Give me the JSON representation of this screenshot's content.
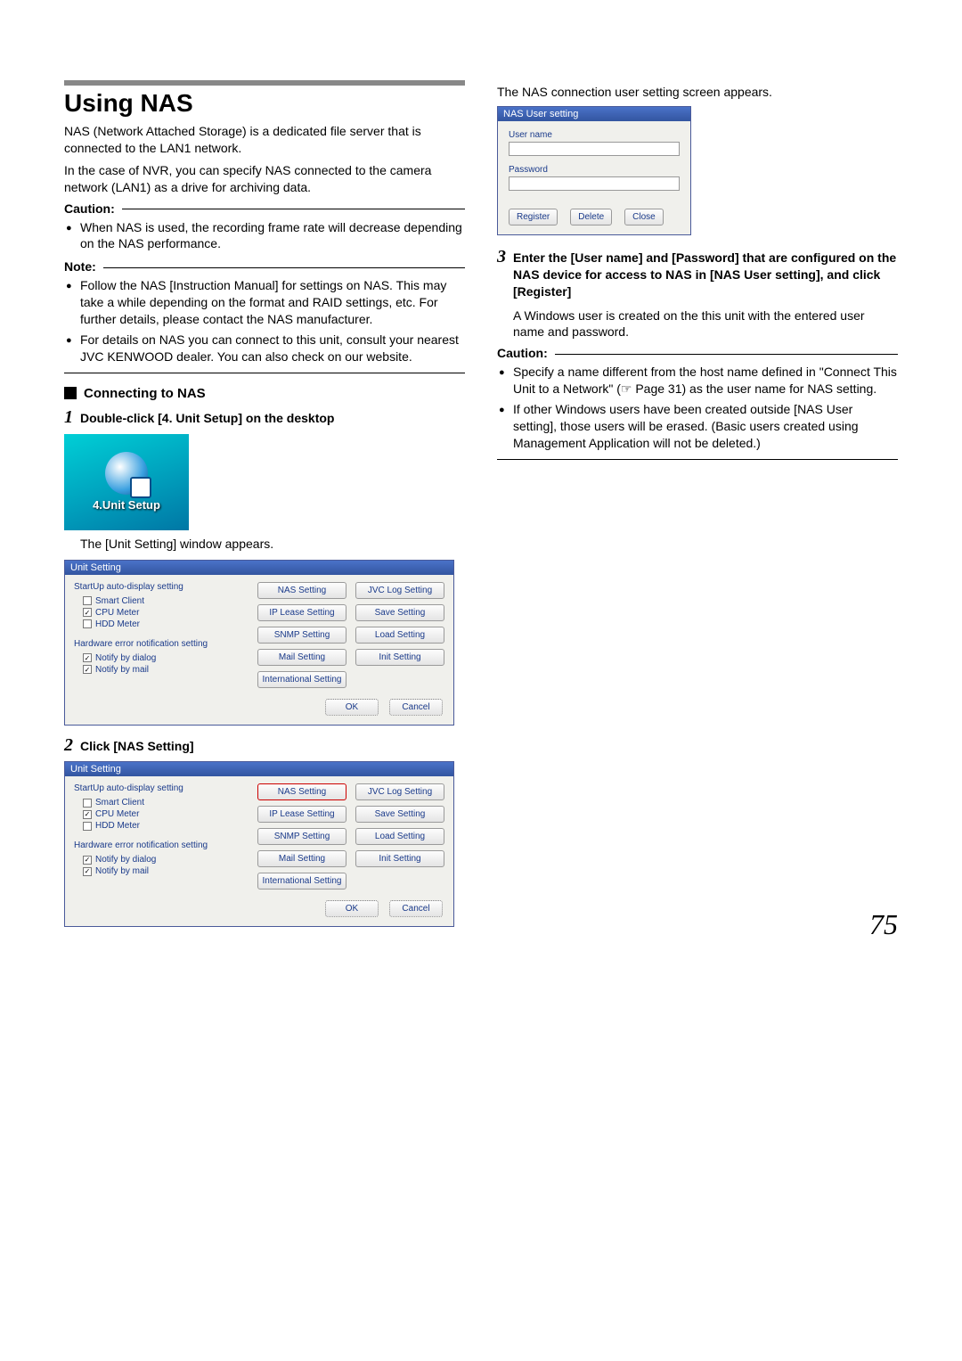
{
  "heading": "Using NAS",
  "intro1": "NAS (Network Attached Storage) is a dedicated file server that is connected to the LAN1 network.",
  "intro2": "In the case of NVR, you can specify NAS connected to the camera network (LAN1) as a drive for archiving data.",
  "caution_label": "Caution:",
  "note_label": "Note:",
  "caution1_items": [
    "When NAS is used, the recording frame rate will decrease depending on the NAS performance."
  ],
  "note1_items": [
    "Follow the NAS [Instruction Manual] for settings on NAS. This may take a while depending on the format and RAID settings, etc. For further details, please contact the NAS manufacturer.",
    "For details on NAS you can connect to this unit, consult your nearest JVC KENWOOD dealer. You can also check on our website."
  ],
  "subhead_connect": "Connecting to NAS",
  "step1": "Double-click [4. Unit Setup] on the desktop",
  "desktop_icon_label": "4.Unit Setup",
  "unit_window_caption": "The [Unit Setting] window appears.",
  "unit_dialog": {
    "title": "Unit Setting",
    "section_startup": "StartUp auto-display setting",
    "chk_smart": "Smart Client",
    "chk_cpu": "CPU Meter",
    "chk_hdd": "HDD Meter",
    "section_hw": "Hardware error notification setting",
    "chk_notify_dialog": "Notify by dialog",
    "chk_notify_mail": "Notify by mail",
    "btns_col1": [
      "NAS Setting",
      "IP Lease Setting",
      "SNMP Setting",
      "Mail Setting",
      "International Setting"
    ],
    "btns_col2": [
      "JVC Log Setting",
      "Save Setting",
      "Load Setting",
      "Init Setting"
    ],
    "ok": "OK",
    "cancel": "Cancel"
  },
  "step2": "Click [NAS Setting]",
  "col2_caption": "The NAS connection user setting screen appears.",
  "nas_dialog": {
    "title": "NAS User setting",
    "user_label": "User name",
    "pass_label": "Password",
    "register": "Register",
    "delete": "Delete",
    "close": "Close"
  },
  "step3": "Enter the [User name] and [Password] that are configured on the NAS device for access to NAS in [NAS User setting], and click [Register]",
  "step3_caption": "A Windows user is created on the this unit with the entered user name and password.",
  "caution2_items": [
    "Specify a name different from the host name defined in \"Connect This Unit to a Network\" (☞ Page 31) as the user name for NAS setting.",
    "If other Windows users have been created outside [NAS User setting], those users will be erased. (Basic users created using Management Application will not be deleted.)"
  ],
  "page_number": "75"
}
